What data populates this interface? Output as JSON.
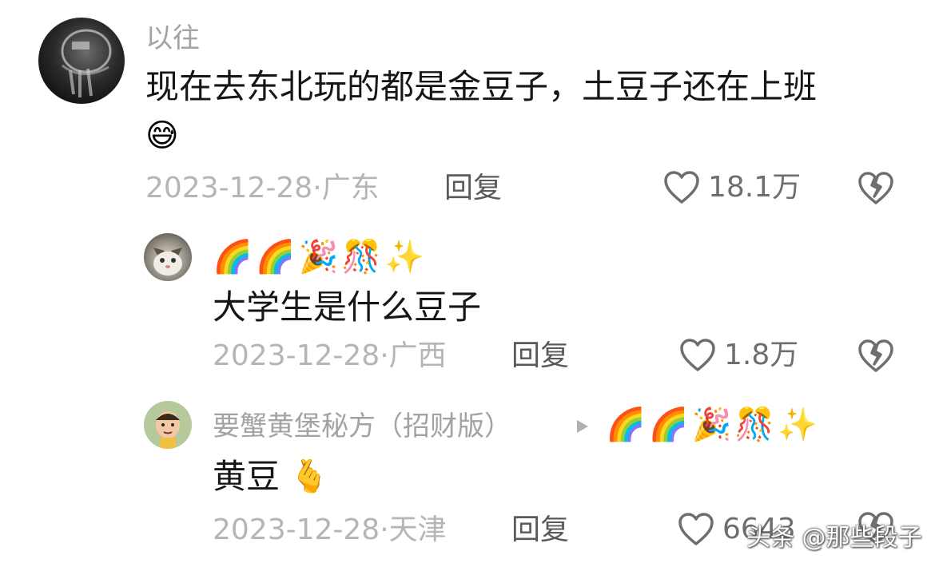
{
  "comments": [
    {
      "author": "以往",
      "text_line1": "现在去东北玩的都是金豆子，土豆子还在上班",
      "text_emoji": "😅",
      "date": "2023-12-28·广东",
      "reply_label": "回复",
      "likes": "18.1万"
    },
    {
      "author_emojis": "🌈🌈🎉🎊✨",
      "text": "大学生是什么豆子",
      "date": "2023-12-28·广西",
      "reply_label": "回复",
      "likes": "1.8万"
    },
    {
      "author": "要蟹黄堡秘方（招财版）",
      "reply_to_emojis": "🌈🌈🎉🎊✨",
      "text": "黄豆",
      "text_emoji": "🫰",
      "date": "2023-12-28·天津",
      "reply_label": "回复",
      "likes": "6643"
    }
  ],
  "watermark": "头条 @那些段子",
  "icons": [
    "heart-outline-icon",
    "dislike-broken-heart-icon",
    "reply-arrow-icon"
  ]
}
